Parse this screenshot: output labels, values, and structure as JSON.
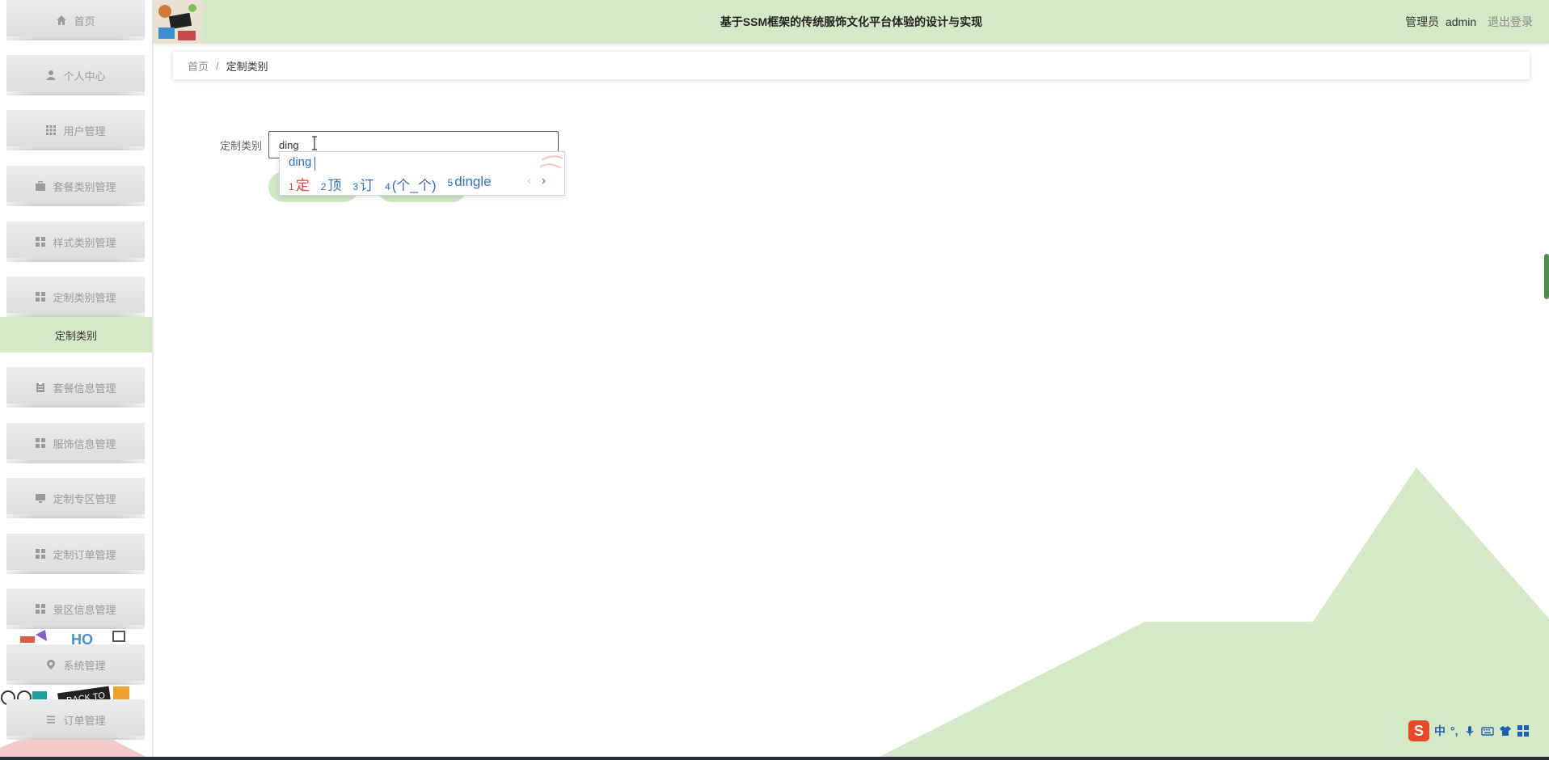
{
  "header": {
    "title": "基于SSM框架的传统服饰文化平台体验的设计与实现",
    "role": "管理员",
    "username": "admin",
    "logout": "退出登录"
  },
  "sidebar": {
    "items": [
      {
        "label": "首页",
        "icon": "home-icon"
      },
      {
        "label": "个人中心",
        "icon": "user-icon"
      },
      {
        "label": "用户管理",
        "icon": "grid-icon"
      },
      {
        "label": "套餐类别管理",
        "icon": "briefcase-icon"
      },
      {
        "label": "样式类别管理",
        "icon": "apps-icon"
      },
      {
        "label": "定制类别管理",
        "icon": "apps-icon"
      },
      {
        "label": "套餐信息管理",
        "icon": "clipboard-icon"
      },
      {
        "label": "服饰信息管理",
        "icon": "apps-icon"
      },
      {
        "label": "定制专区管理",
        "icon": "monitor-icon"
      },
      {
        "label": "定制订单管理",
        "icon": "apps-icon"
      },
      {
        "label": "景区信息管理",
        "icon": "apps-icon"
      },
      {
        "label": "系统管理",
        "icon": "location-icon"
      },
      {
        "label": "订单管理",
        "icon": "list-icon"
      }
    ],
    "submenu_active": "定制类别"
  },
  "breadcrumb": {
    "home": "首页",
    "separator": "/",
    "current": "定制类别"
  },
  "form": {
    "label": "定制类别",
    "value": "ding"
  },
  "ime": {
    "pinyin": "ding",
    "candidates": [
      {
        "num": "1",
        "text": "定"
      },
      {
        "num": "2",
        "text": "顶"
      },
      {
        "num": "3",
        "text": "订"
      },
      {
        "num": "4",
        "text": "(个_个)"
      },
      {
        "num": "5",
        "text": "dingle"
      }
    ],
    "prev": "‹",
    "next": "›",
    "status_logo": "S",
    "status_mode": "中",
    "status_punct": "°,"
  },
  "colors": {
    "theme_green": "#d4eac7",
    "button_green": "#cfe8c2",
    "menu_grey": "#e2e2e2",
    "ime_blue": "#2f6fc1",
    "ime_red": "#e04040"
  }
}
